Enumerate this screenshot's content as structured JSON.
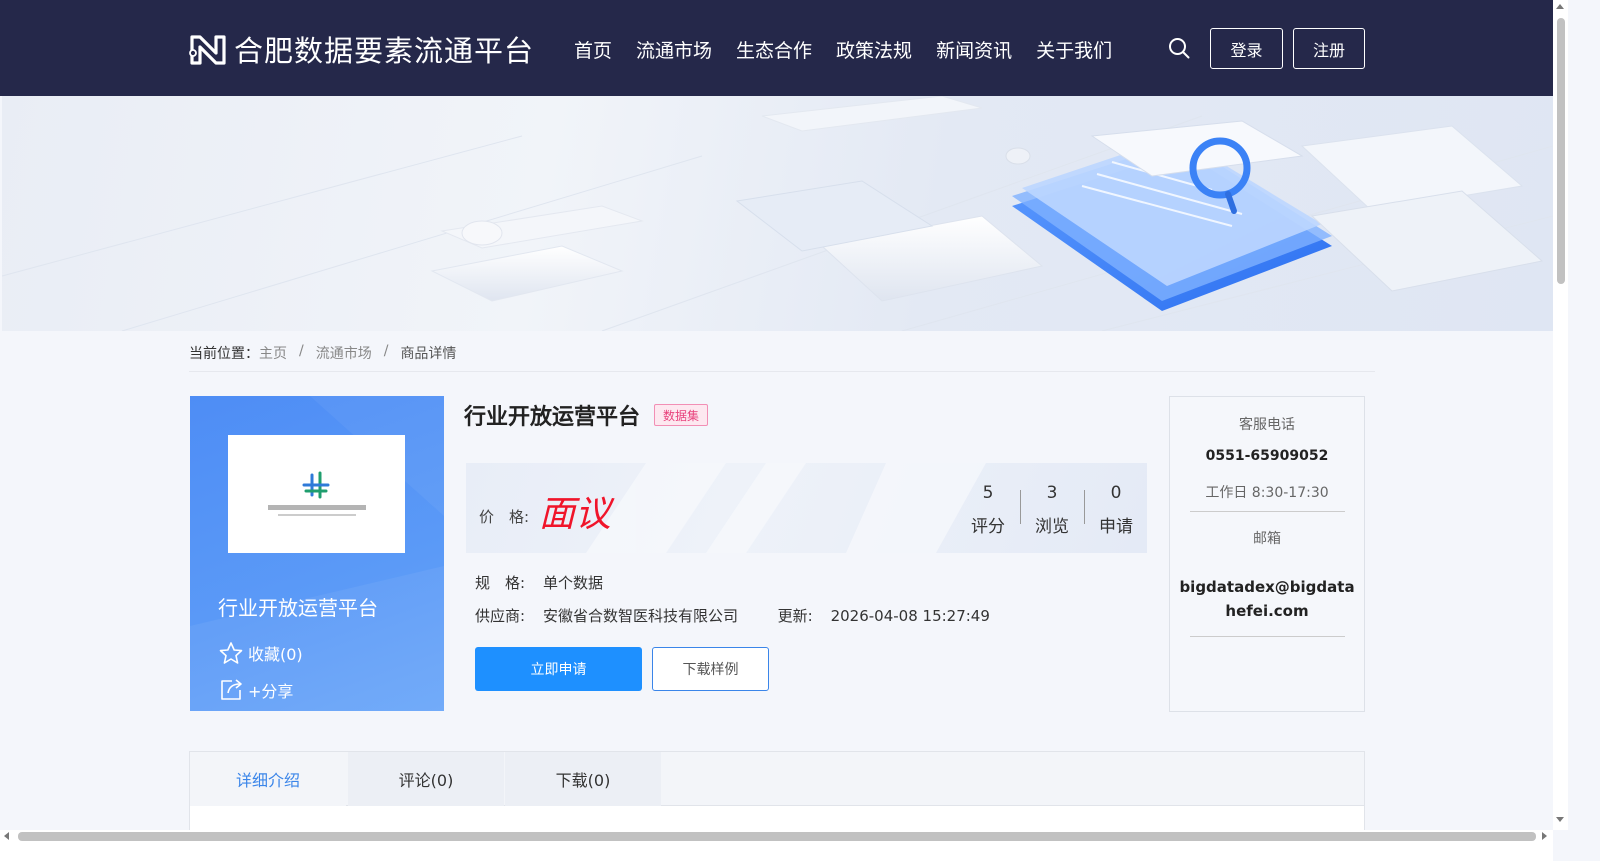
{
  "header": {
    "logo_text": "合肥数据要素流通平台",
    "nav": [
      "首页",
      "流通市场",
      "生态合作",
      "政策法规",
      "新闻资讯",
      "关于我们"
    ],
    "login_label": "登录",
    "register_label": "注册"
  },
  "breadcrumb": {
    "prefix": "当前位置：",
    "items": [
      "主页",
      "流通市场"
    ],
    "separator": "/",
    "current": "商品详情"
  },
  "product_card": {
    "title": "行业开放运营平台",
    "favorite_label": "收藏(0)",
    "share_label": "+分享"
  },
  "product": {
    "title": "行业开放运营平台",
    "type_badge": "数据集",
    "price_label": "价　格:",
    "price_value": "面议",
    "stats": [
      {
        "value": "5",
        "label": "评分"
      },
      {
        "value": "3",
        "label": "浏览"
      },
      {
        "value": "0",
        "label": "申请"
      }
    ],
    "spec_label": "规　格:",
    "spec_value": "单个数据",
    "supplier_label": "供应商:",
    "supplier_value": "安徽省合数智医科技有限公司",
    "updated_label": "更新:",
    "updated_value": "2026-04-08 15:27:49",
    "apply_label": "立即申请",
    "sample_label": "下载样例"
  },
  "contact": {
    "phone_label": "客服电话",
    "phone": "0551-65909052",
    "hours": "工作日 8:30-17:30",
    "email_label": "邮箱",
    "email_line1": "bigdatadex@bigdata",
    "email_line2": "hefei.com"
  },
  "tabs": [
    "详细介绍",
    "评论(0)",
    "下载(0)"
  ],
  "colors": {
    "header_bg": "#25284a",
    "accent": "#1e90ff",
    "price": "#f0142a",
    "badge": "#e8427c"
  }
}
